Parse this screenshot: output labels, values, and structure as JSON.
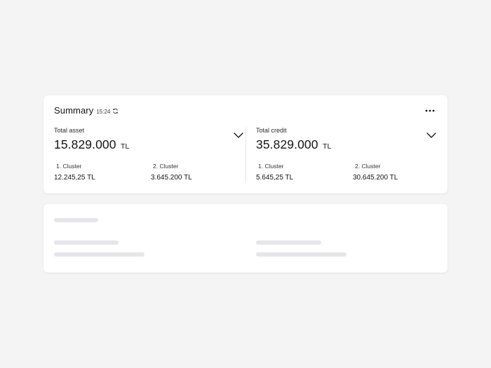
{
  "summary": {
    "title": "Summary",
    "time": "15:24",
    "refresh_icon": "refresh-icon",
    "more_icon": "more-horizontal-icon"
  },
  "total_asset": {
    "label": "Total asset",
    "amount": "15.829.000",
    "currency": "TL",
    "clusters": [
      {
        "label": "1. Cluster",
        "value": "12.245,25 TL"
      },
      {
        "label": "2. Cluster",
        "value": "3.645.200 TL"
      }
    ]
  },
  "total_credit": {
    "label": "Total credit",
    "amount": "35.829.000",
    "currency": "TL",
    "clusters": [
      {
        "label": "1. Cluster",
        "value": "5.645,25 TL"
      },
      {
        "label": "2. Cluster",
        "value": "30.645.200 TL"
      }
    ]
  },
  "colors": {
    "background": "#f4f4f5",
    "card": "#ffffff",
    "text": "#141414",
    "skeleton": "#e6e6ea"
  }
}
